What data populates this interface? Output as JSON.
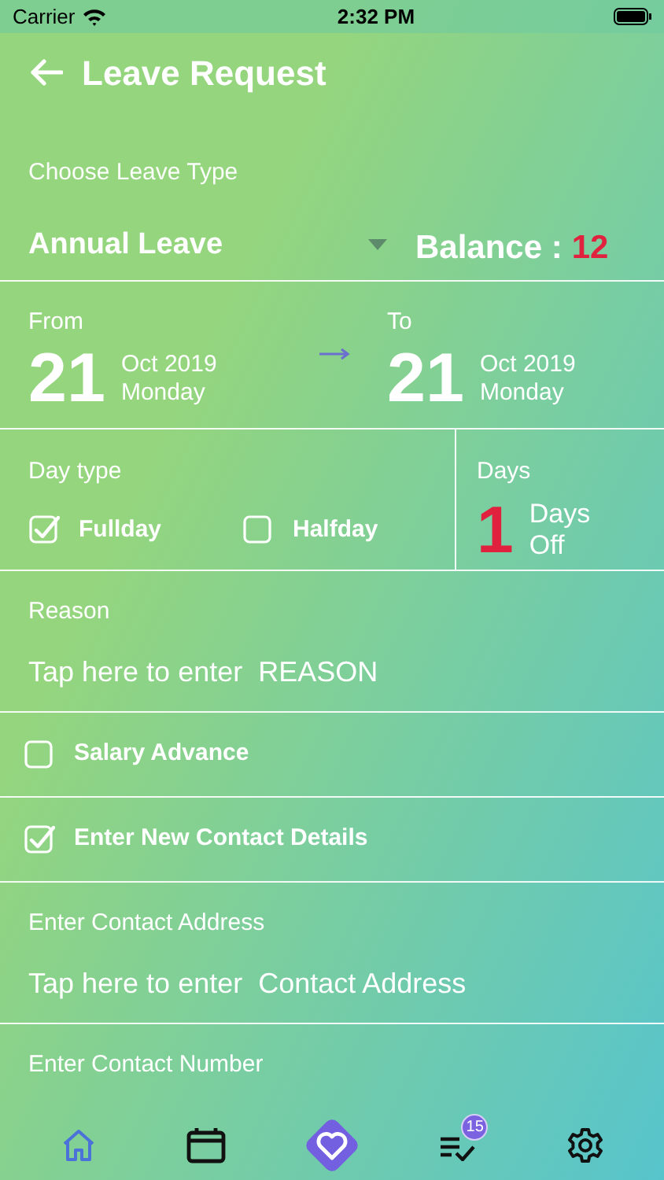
{
  "status_bar": {
    "carrier": "Carrier",
    "time": "2:32 PM"
  },
  "header": {
    "title": "Leave Request"
  },
  "leave_type": {
    "label": "Choose Leave Type",
    "value": "Annual Leave",
    "balance_label": "Balance :",
    "balance_value": "12"
  },
  "dates": {
    "from": {
      "label": "From",
      "day": "21",
      "month_year": "Oct 2019",
      "weekday": "Monday"
    },
    "to": {
      "label": "To",
      "day": "21",
      "month_year": "Oct 2019",
      "weekday": "Monday"
    }
  },
  "day_type": {
    "label": "Day type",
    "options": [
      {
        "label": "Fullday",
        "checked": true
      },
      {
        "label": "Halfday",
        "checked": false
      }
    ]
  },
  "days": {
    "label": "Days",
    "count": "1",
    "unit": "Days Off"
  },
  "reason": {
    "label": "Reason",
    "placeholder": "Tap here to enter  REASON"
  },
  "options": [
    {
      "label": "Salary Advance",
      "checked": false
    },
    {
      "label": "Enter New Contact Details",
      "checked": true
    }
  ],
  "contact_address": {
    "label": "Enter Contact Address",
    "placeholder": "Tap here to enter  Contact Address"
  },
  "contact_number": {
    "label": "Enter Contact Number"
  },
  "tab_bar": [
    {
      "kind": "home",
      "selected": true
    },
    {
      "kind": "calendar",
      "selected": false
    },
    {
      "kind": "heart",
      "selected": false
    },
    {
      "kind": "tasks",
      "selected": false,
      "badge": "15"
    },
    {
      "kind": "settings",
      "selected": false
    }
  ]
}
